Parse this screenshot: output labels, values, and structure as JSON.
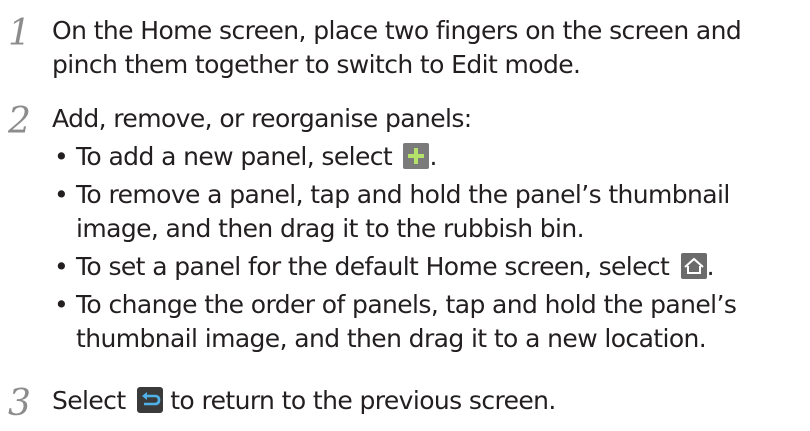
{
  "steps": [
    {
      "number": "1",
      "lines": [
        "On the Home screen, place two fingers on the screen and",
        "pinch them together to switch to Edit mode."
      ]
    },
    {
      "number": "2",
      "heading": "Add, remove, or reorganise panels:",
      "bullets": [
        {
          "marker": "•",
          "text_before_icon": "To add a new panel, select ",
          "icon": "plus-icon",
          "text_after_icon": "."
        },
        {
          "marker": "•",
          "lines": [
            "To remove a panel, tap and hold the panel’s thumbnail",
            "image, and then drag it to the rubbish bin."
          ]
        },
        {
          "marker": "•",
          "text_before_icon": "To set a panel for the default Home screen, select ",
          "icon": "home-icon",
          "text_after_icon": "."
        },
        {
          "marker": "•",
          "lines": [
            "To change the order of panels, tap and hold the panel’s",
            "thumbnail image, and then drag it to a new location."
          ]
        }
      ]
    },
    {
      "number": "3",
      "text_before_icon": "Select ",
      "icon": "back-icon",
      "text_after_icon": " to return to the previous screen."
    }
  ],
  "colors": {
    "text": "#231f20",
    "step_number": "#8c8c8c",
    "icon_plus_bg": "#7b7b7b",
    "icon_home_bg": "#6b6b6b",
    "icon_back_bg": "#3a3a3a"
  }
}
